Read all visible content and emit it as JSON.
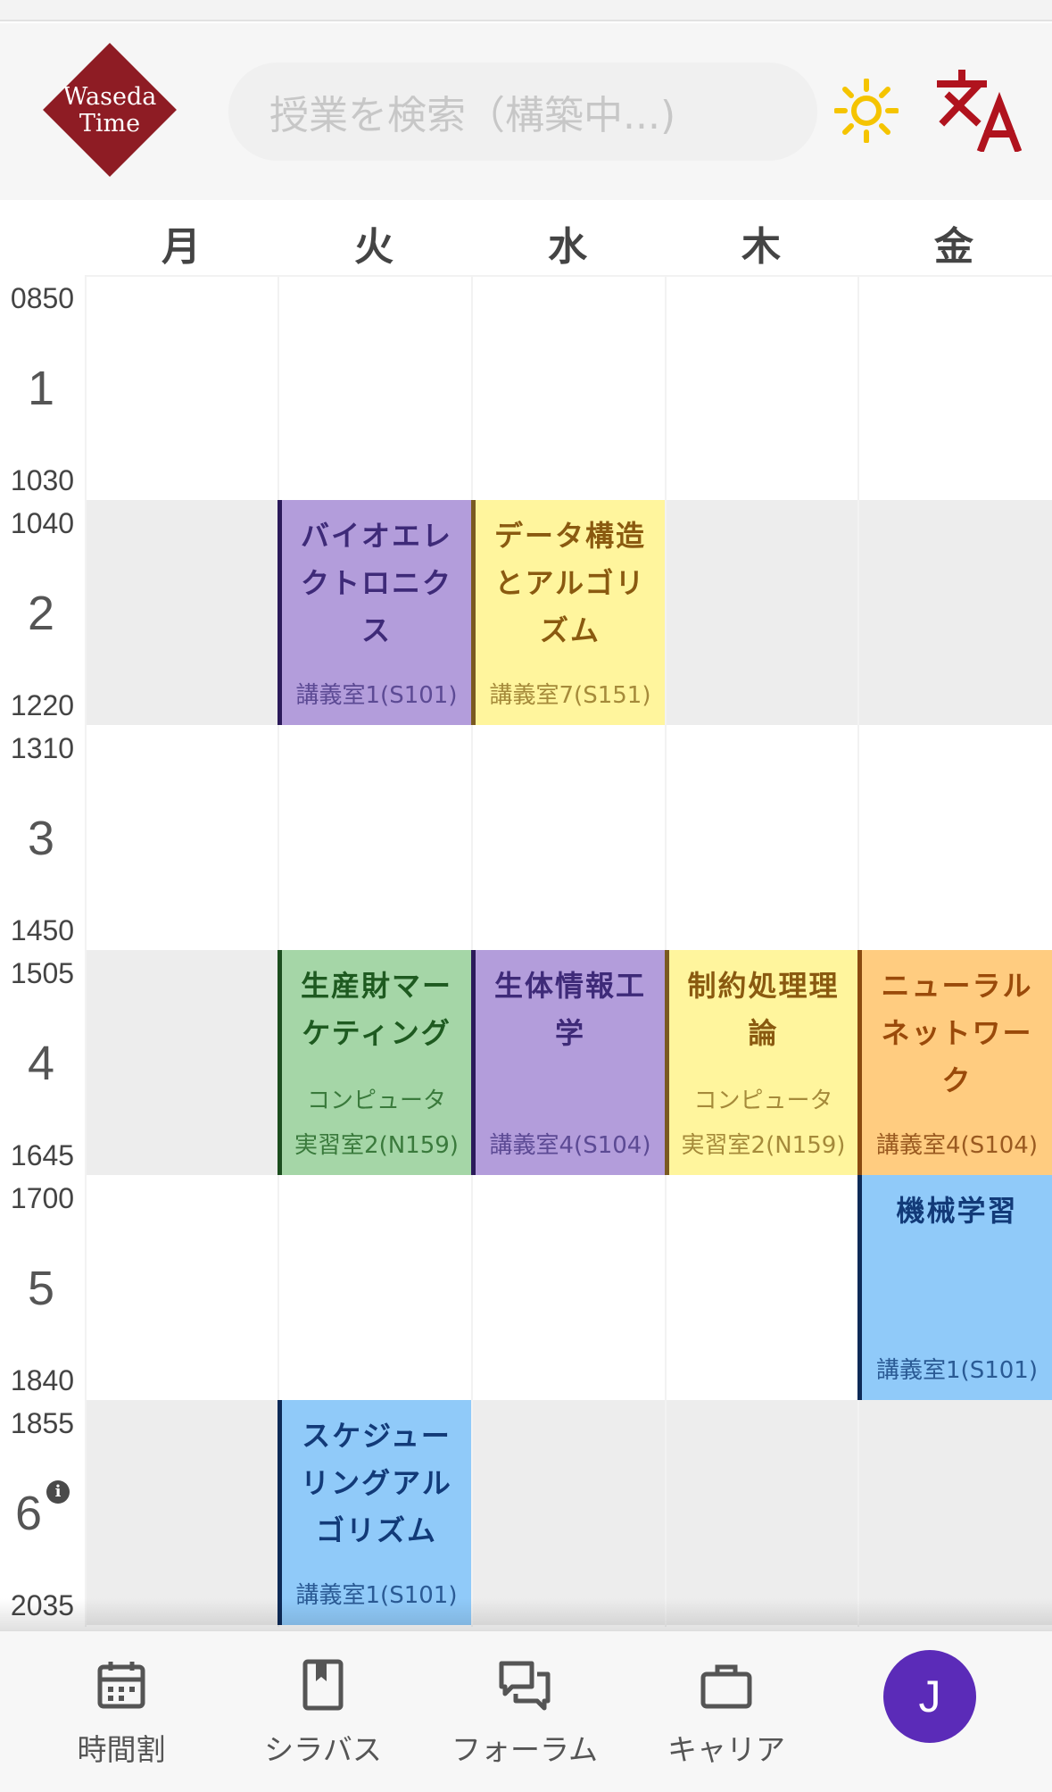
{
  "header": {
    "logo_line1": "Waseda",
    "logo_line2": "Time",
    "search_placeholder": "授業を検索（構築中...)",
    "theme_icon": "sun-icon",
    "language_icon": "translate-icon"
  },
  "days": [
    "月",
    "火",
    "水",
    "木",
    "金"
  ],
  "periods": [
    {
      "num": "1",
      "start": "0850",
      "end": "1030"
    },
    {
      "num": "2",
      "start": "1040",
      "end": "1220"
    },
    {
      "num": "3",
      "start": "1310",
      "end": "1450"
    },
    {
      "num": "4",
      "start": "1505",
      "end": "1645"
    },
    {
      "num": "5",
      "start": "1700",
      "end": "1840"
    },
    {
      "num": "6",
      "start": "1855",
      "end": "2035",
      "info_icon": "info-icon"
    }
  ],
  "courses": {
    "bioelectronics": {
      "title": "バイオエレクトロニクス",
      "room": "講義室1(S101)"
    },
    "data_structures": {
      "title": "データ構造とアルゴリズム",
      "room": "講義室7(S151)"
    },
    "marketing": {
      "title": "生産財マーケティング",
      "room_line1": "コンピュータ",
      "room_line2": "実習室2(N159)"
    },
    "bioinformatics": {
      "title": "生体情報工学",
      "room": "講義室4(S104)"
    },
    "constraint": {
      "title": "制約処理理論",
      "room_line1": "コンピュータ",
      "room_line2": "実習室2(N159)"
    },
    "neural_network": {
      "title": "ニューラルネットワーク",
      "room": "講義室4(S104)"
    },
    "machine_learning": {
      "title": "機械学習",
      "room": "講義室1(S101)"
    },
    "scheduling": {
      "title": "スケジューリングアルゴリズム",
      "room": "講義室1(S101)"
    }
  },
  "colors": {
    "purple": "#b39ddb",
    "yellow": "#fff59d",
    "green": "#a5d6a7",
    "orange": "#ffcc80",
    "blue": "#90caf9",
    "brand": "#8e1c24",
    "avatar": "#5b2bb8"
  },
  "navbar": {
    "timetable": "時間割",
    "syllabus": "シラバス",
    "forum": "フォーラム",
    "career": "キャリア",
    "avatar_initial": "J"
  }
}
